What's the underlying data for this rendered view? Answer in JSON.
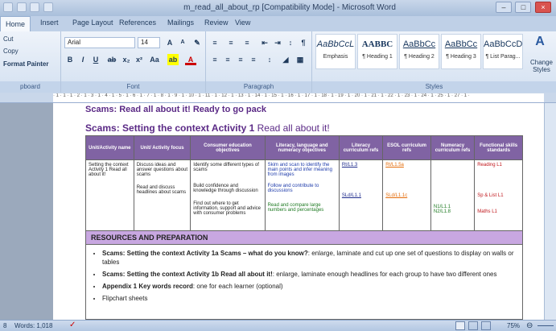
{
  "window": {
    "title": "m_read_all_about_rp [Compatibility Mode] - Microsoft Word"
  },
  "tabs": [
    "Home",
    "Insert",
    "Page Layout",
    "References",
    "Mailings",
    "Review",
    "View"
  ],
  "clipboard": {
    "cut": "Cut",
    "copy": "Copy",
    "format_painter": "Format Painter",
    "label": "pboard"
  },
  "font": {
    "name": "Arial",
    "size": "14",
    "label": "Font"
  },
  "paragraph": {
    "label": "Paragraph"
  },
  "styles": {
    "label": "Styles",
    "change": "Change Styles",
    "items": [
      {
        "preview": "AaBbCcL",
        "name": "Emphasis"
      },
      {
        "preview": "AABBC",
        "name": "¶ Heading 1"
      },
      {
        "preview": "AaBbCc",
        "name": "¶ Heading 2"
      },
      {
        "preview": "AaBbCc",
        "name": "¶ Heading 3"
      },
      {
        "preview": "AaBbCcD",
        "name": "¶ List Parag..."
      }
    ]
  },
  "ruler": "· 1 · 1 · 1 · 2 · 1 · 3 · 1 · 4 · 1 · 5 · 1 · 6 · 1 · 7 · 1 · 8 · 1 · 9 · 1 · 10 · 1 · 11 · 1 · 12 · 1 · 13 · 1 · 14 · 1 · 15 · 1 · 16 · 1 · 17 · 1 · 18 · 1 · 19 · 1 · 20 · 1 · 21 · 1 · 22 · 1 · 23 · 1 · 24 · 1 · 25 · 1 · 27 · 1 ·",
  "doc": {
    "heading1": "Scams: Read all about it! Ready to go pack",
    "heading2_bold": "Scams: Setting the context Activity 1",
    "heading2_rest": " Read all about it!",
    "table_headers": [
      "Unit/Activity name",
      "Unit/ Activity focus",
      "Consumer education objectives",
      "Literacy, language and numeracy objectives",
      "Literacy curriculum refs",
      "ESOL curriculum refs",
      "Numeracy curriculum refs",
      "Functional skills standards"
    ],
    "row": {
      "name": "Setting the context Activity 1 Read all about it!",
      "focus1": "Discuss ideas and answer questions about scams",
      "focus2": "Read and discuss headlines about scams",
      "consumer1": "Identify some different types of scams",
      "consumer2": "Build confidence and knowledge through discussion",
      "consumer3": "Find out where to get information, support and advice with consumer problems",
      "lln1": "Skim and scan to identify the main points and infer meaning from images",
      "lln2": "Follow and contribute to discussions",
      "lln3": "Read and compare large numbers and percentages",
      "lit1": "Rt/L1.3",
      "lit2": "SLd/L1.1",
      "esol1": "Rt/L1.5a",
      "esol2": "SLd/L1.1c",
      "num1": "N1/L1.1",
      "num2": "N2/L1.8",
      "fs1": "Reading L1",
      "fs2": "Sp & List L1",
      "fs3": "Maths L1"
    },
    "resources_heading": "RESOURCES AND PREPARATION",
    "resources": [
      {
        "bold": "Scams: Setting the context Activity 1a Scams – what do you know?",
        "rest": ": enlarge, laminate and cut up one set of questions to display on walls or tables"
      },
      {
        "bold": "Scams: Setting the context Activity 1b Read all about it!",
        "rest": ": enlarge, laminate enough headlines for each group to have two different ones"
      },
      {
        "bold": "Appendix 1 Key words record",
        "rest": ": one for each learner (optional)"
      },
      {
        "bold": "",
        "rest": "Flipchart sheets"
      }
    ]
  },
  "status": {
    "page": "8",
    "words": "Words: 1,018",
    "zoom": "75%"
  }
}
